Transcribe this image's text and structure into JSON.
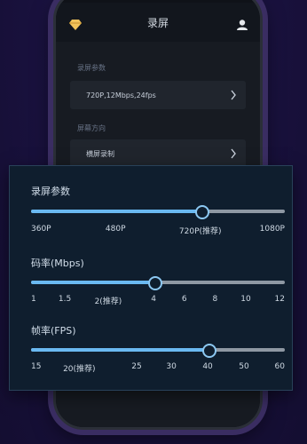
{
  "app": {
    "title": "录屏",
    "left_icon": "gem-icon",
    "right_icon": "user-switch-icon",
    "sections": [
      {
        "label": "录屏参数",
        "value": "720P,12Mbps,24fps"
      },
      {
        "label": "屏幕方向",
        "value": "横屏录制"
      }
    ]
  },
  "panel": {
    "groups": [
      {
        "title": "录屏参数",
        "ticks": [
          "360P",
          "480P",
          "720P(推荐)",
          "1080P"
        ],
        "selected_index": 2
      },
      {
        "title": "码率(Mbps)",
        "ticks": [
          "1",
          "1.5",
          "2(推荐)",
          "4",
          "6",
          "8",
          "10",
          "12"
        ],
        "selected_index": 3
      },
      {
        "title": "帧率(FPS)",
        "ticks": [
          "15",
          "20(推荐)",
          "25",
          "30",
          "40",
          "50",
          "60"
        ],
        "selected_index": 4
      }
    ]
  },
  "colors": {
    "accent": "#6ab9f1",
    "track": "#8e98a3",
    "panel_bg": "#0f1e2e"
  }
}
